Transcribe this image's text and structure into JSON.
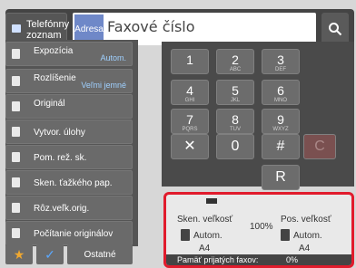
{
  "top": {
    "phonebook_label": "Telefónny zoznam",
    "address_tag": "Adresa",
    "address_placeholder": "Faxové číslo"
  },
  "left": {
    "items": [
      {
        "label": "Expozícia",
        "sub": "Autom."
      },
      {
        "label": "Rozlíšenie",
        "sub": "Veľmi jemné"
      },
      {
        "label": "Originál",
        "sub": ""
      },
      {
        "label": "Vytvor. úlohy",
        "sub": ""
      },
      {
        "label": "Pom. rež. sk.",
        "sub": ""
      },
      {
        "label": "Sken. ťažkého pap.",
        "sub": ""
      },
      {
        "label": "Rôz.veľk.orig.",
        "sub": ""
      },
      {
        "label": "Počítanie originálov",
        "sub": ""
      }
    ],
    "other_label": "Ostatné"
  },
  "keypad": [
    {
      "num": "1",
      "let": ""
    },
    {
      "num": "2",
      "let": "ABC"
    },
    {
      "num": "3",
      "let": "DEF"
    },
    {
      "num": "4",
      "let": "GHI"
    },
    {
      "num": "5",
      "let": "JKL"
    },
    {
      "num": "6",
      "let": "MNO"
    },
    {
      "num": "7",
      "let": "PQRS"
    },
    {
      "num": "8",
      "let": "TUV"
    },
    {
      "num": "9",
      "let": "WXYZ"
    },
    {
      "num": "✕",
      "let": ""
    },
    {
      "num": "0",
      "let": ""
    },
    {
      "num": "#",
      "let": ""
    },
    {
      "num": "C",
      "let": ""
    },
    {
      "num": "R",
      "let": ""
    }
  ],
  "status": {
    "scan_size_label": "Sken. veľkosť",
    "scan_size_value": "Autom.",
    "scan_paper": "A4",
    "ratio": "100%",
    "send_size_label": "Pos. veľkosť",
    "send_size_value": "Autom.",
    "send_paper": "A4",
    "memory_label": "Pamäť prijatých faxov:",
    "memory_value": "0%"
  },
  "colors": {
    "highlight": "#e11b2c",
    "accent": "#6f88c8"
  }
}
